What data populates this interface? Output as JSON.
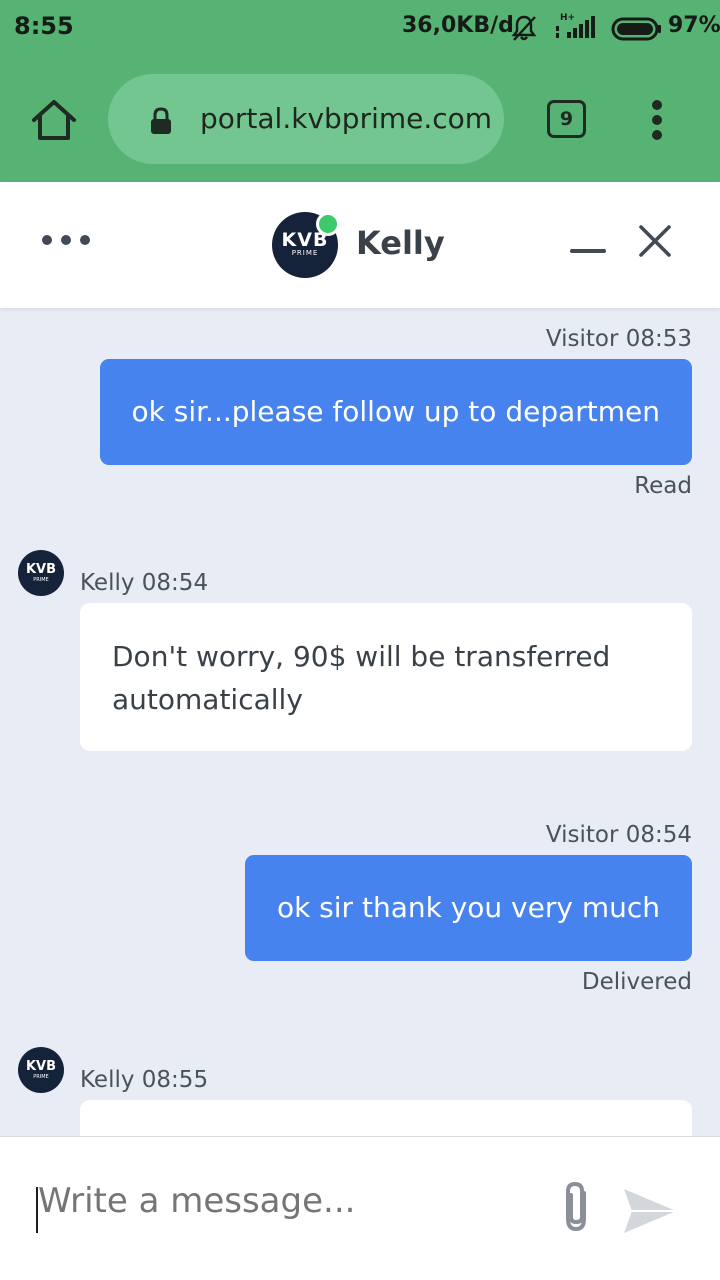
{
  "status_bar": {
    "time": "8:55",
    "network_speed": "36,0KB/d",
    "battery": "97%",
    "icons": [
      "silent-bell-icon",
      "signal-icon",
      "battery-icon"
    ]
  },
  "browser": {
    "url": "portal.kvbprime.com",
    "tab_count": "9",
    "icons": [
      "home-icon",
      "lock-icon",
      "overflow-menu-icon"
    ]
  },
  "chat": {
    "agent_name": "Kelly",
    "brand_logo_text": "KVB",
    "brand_logo_subtext": "PRIME",
    "online_color": "#3ec96d",
    "outgoing_color": "#4683ee",
    "messages": [
      {
        "direction": "out",
        "meta": "Visitor 08:53",
        "text": "ok sir...please follow up to departmen",
        "status": "Read"
      },
      {
        "direction": "in",
        "meta": "Kelly 08:54",
        "text": "Don't worry, 90$ will be transferred automatically"
      },
      {
        "direction": "out",
        "meta": "Visitor 08:54",
        "text": "ok sir thank you very much",
        "status": "Delivered"
      },
      {
        "direction": "in",
        "meta": "Kelly 08:55",
        "text": ""
      }
    ]
  },
  "composer": {
    "placeholder": "Write a message..."
  }
}
